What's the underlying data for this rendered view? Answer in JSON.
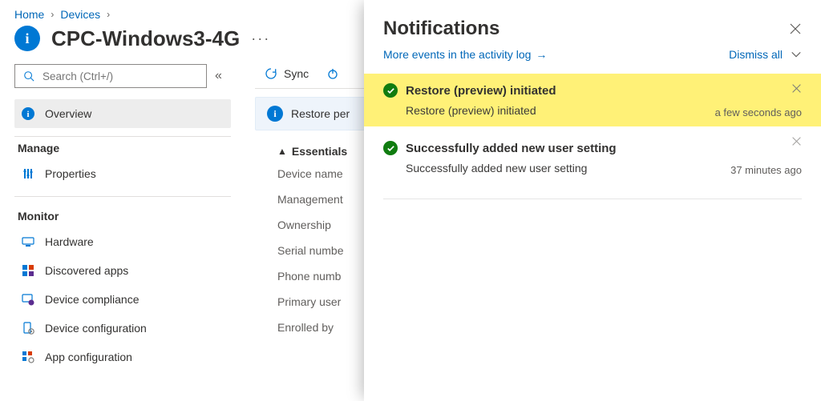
{
  "breadcrumb": {
    "home": "Home",
    "devices": "Devices"
  },
  "page": {
    "title": "CPC-Windows3-4G"
  },
  "sidebar": {
    "search_placeholder": "Search (Ctrl+/)",
    "overview": "Overview",
    "manage_label": "Manage",
    "properties": "Properties",
    "monitor_label": "Monitor",
    "items": [
      "Hardware",
      "Discovered apps",
      "Device compliance",
      "Device configuration",
      "App configuration"
    ]
  },
  "toolbar": {
    "sync": "Sync"
  },
  "status": {
    "text": "Restore per"
  },
  "essentials": {
    "header": "Essentials",
    "rows": [
      "Device name",
      "Management",
      "Ownership",
      "Serial numbe",
      "Phone numb",
      "Primary user",
      "Enrolled by"
    ]
  },
  "panel": {
    "title": "Notifications",
    "more_link": "More events in the activity log",
    "dismiss": "Dismiss all",
    "notifs": [
      {
        "title": "Restore (preview) initiated",
        "body": "Restore (preview) initiated",
        "time": "a few seconds ago",
        "highlight": true
      },
      {
        "title": "Successfully added new user setting",
        "body": "Successfully added new user setting",
        "time": "37 minutes ago",
        "highlight": false
      }
    ]
  }
}
